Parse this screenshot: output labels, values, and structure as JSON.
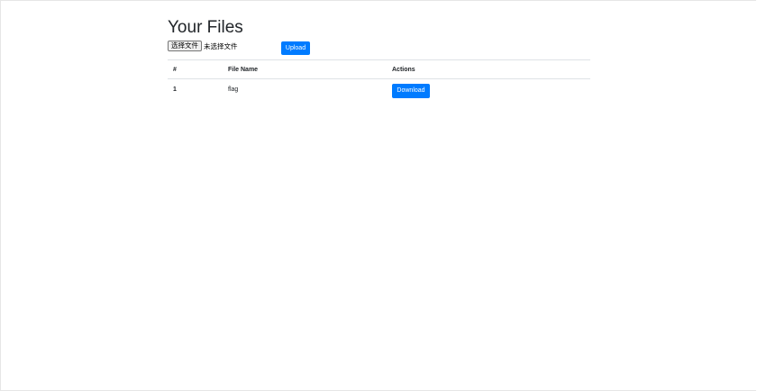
{
  "page": {
    "title": "Your Files"
  },
  "upload": {
    "choose_file_label": "选择文件",
    "no_file_label": "未选择文件",
    "upload_label": "Upload"
  },
  "table": {
    "headers": [
      "#",
      "File Name",
      "Actions"
    ],
    "rows": [
      {
        "num": "1",
        "name": "flag",
        "action_label": "Download"
      }
    ]
  },
  "colors": {
    "primary": "#007bff",
    "text": "#212529",
    "border": "#dee2e6"
  }
}
